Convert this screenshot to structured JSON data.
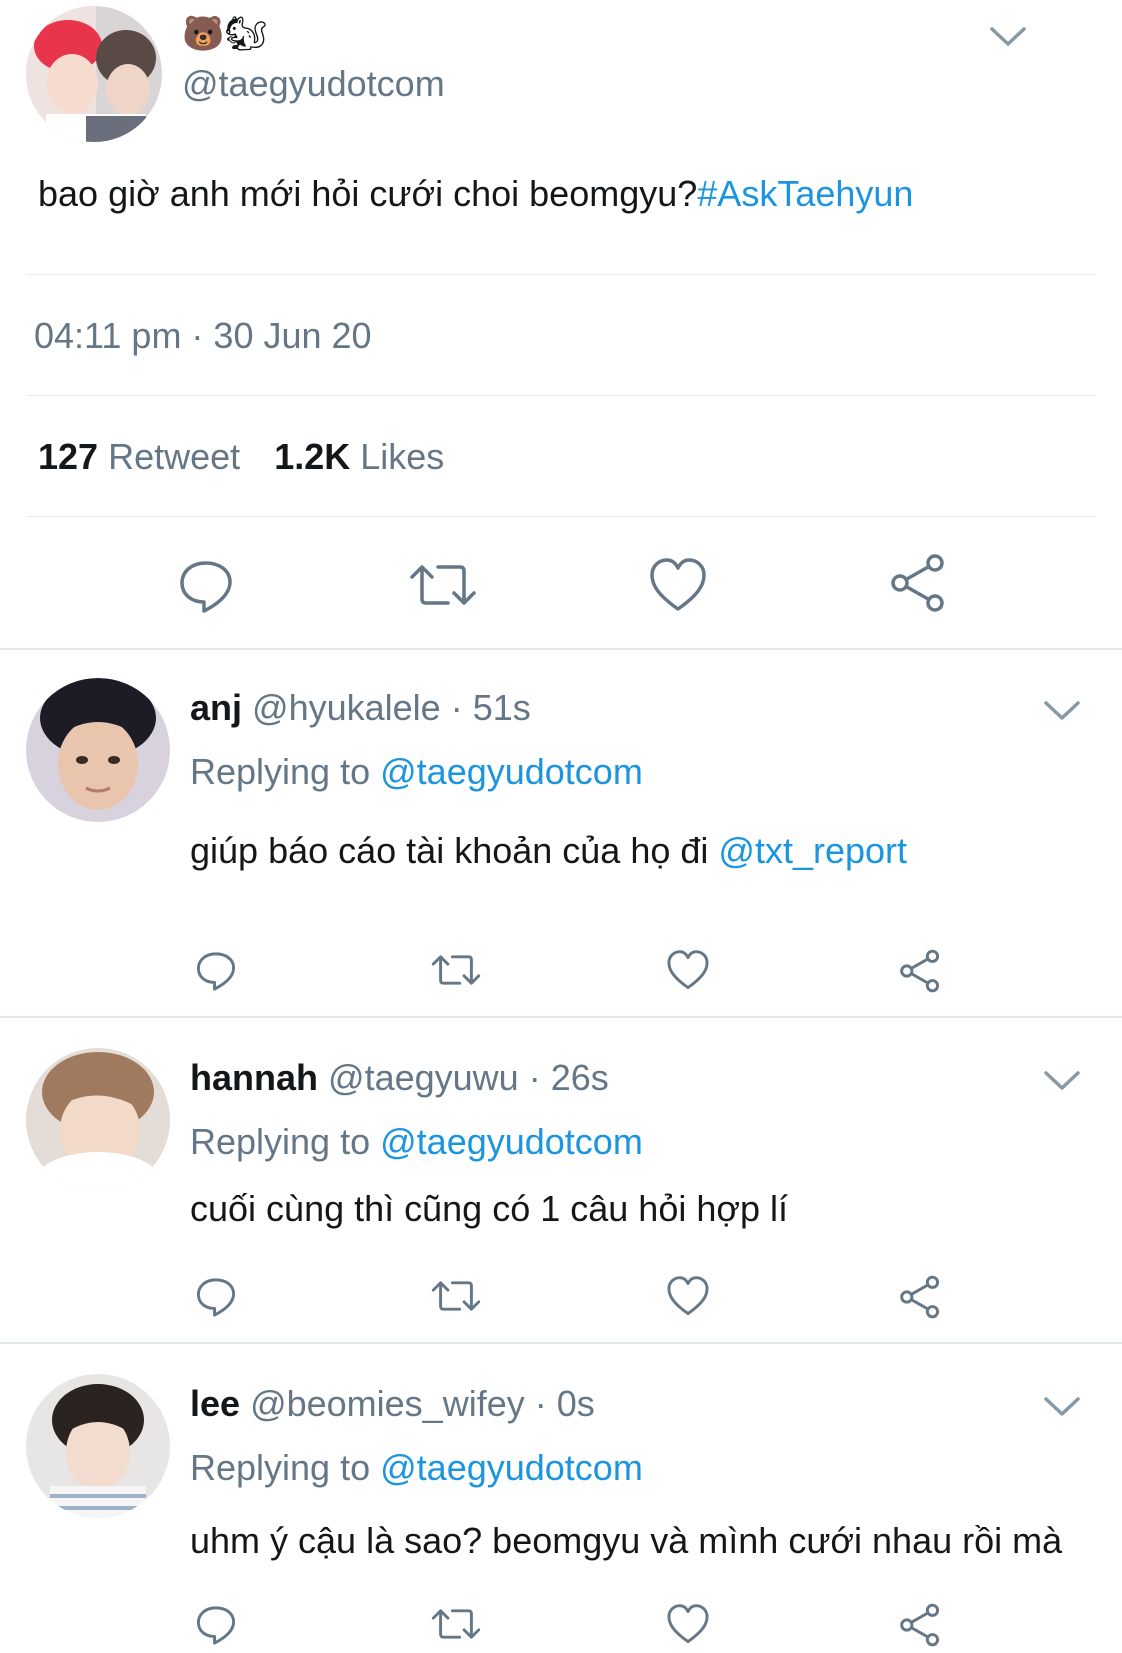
{
  "main_tweet": {
    "display_name_emoji": "🐻🐿",
    "handle": "@taegyudotcom",
    "text": "bao giờ anh mới hỏi cưới choi beomgyu?",
    "hashtag": "#AskTaehyun",
    "timestamp": "04:11 pm · 30 Jun 20",
    "retweet_count": "127",
    "retweet_label": "Retweet",
    "like_count": "1.2K",
    "like_label": "Likes"
  },
  "replies": [
    {
      "name": "anj",
      "handle": "@hyukalele",
      "time": "· 51s",
      "replying_label": "Replying to",
      "replying_to": "@taegyudotcom",
      "text": "giúp báo cáo tài khoản của họ đi",
      "mention": "@txt_report"
    },
    {
      "name": "hannah",
      "handle": "@taegyuwu",
      "time": "· 26s",
      "replying_label": "Replying to",
      "replying_to": "@taegyudotcom",
      "text": "cuối cùng thì cũng có 1 câu hỏi hợp lí"
    },
    {
      "name": "lee",
      "handle": "@beomies_wifey",
      "time": "· 0s",
      "replying_label": "Replying to",
      "replying_to": "@taegyudotcom",
      "text": "uhm ý cậu là sao? beomgyu và mình cưới nhau rồi mà"
    }
  ],
  "colors": {
    "text": "#14171a",
    "secondary": "#657786",
    "link": "#1b95e0",
    "divider": "#e6ecf0"
  },
  "icons": [
    "chevron-down-icon",
    "reply-icon",
    "retweet-icon",
    "like-icon",
    "share-icon"
  ]
}
